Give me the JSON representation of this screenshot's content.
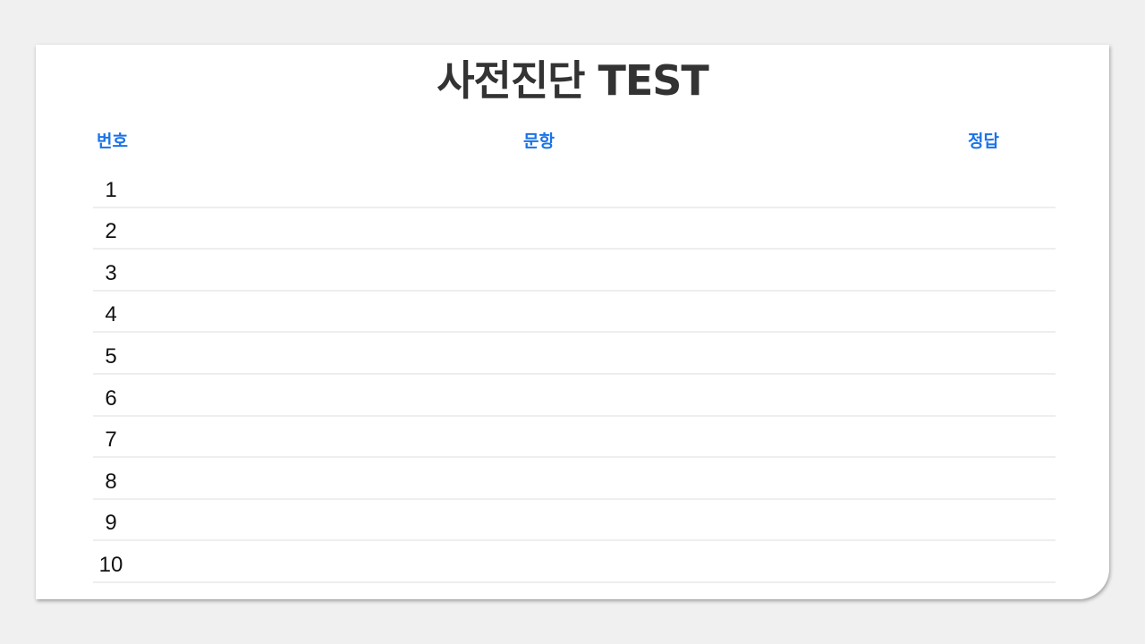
{
  "page": {
    "title": "사전진단 TEST"
  },
  "table": {
    "headers": {
      "number": "번호",
      "question": "문항",
      "answer": "정답"
    },
    "rows": [
      {
        "number": "1",
        "question": "",
        "answer": ""
      },
      {
        "number": "2",
        "question": "",
        "answer": ""
      },
      {
        "number": "3",
        "question": "",
        "answer": ""
      },
      {
        "number": "4",
        "question": "",
        "answer": ""
      },
      {
        "number": "5",
        "question": "",
        "answer": ""
      },
      {
        "number": "6",
        "question": "",
        "answer": ""
      },
      {
        "number": "7",
        "question": "",
        "answer": ""
      },
      {
        "number": "8",
        "question": "",
        "answer": ""
      },
      {
        "number": "9",
        "question": "",
        "answer": ""
      },
      {
        "number": "10",
        "question": "",
        "answer": ""
      }
    ]
  },
  "colors": {
    "header_accent": "#1a73e8",
    "title": "#333333",
    "background": "#f0f0f0",
    "card": "#ffffff"
  }
}
